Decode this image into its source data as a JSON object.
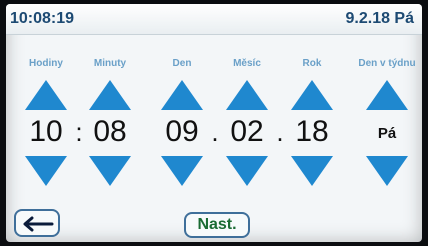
{
  "header": {
    "time": "10:08:19",
    "date": "9.2.18 Pá"
  },
  "fields": [
    {
      "label": "Hodiny",
      "value": "10"
    },
    {
      "label": "Minuty",
      "value": "08"
    },
    {
      "label": "Den",
      "value": "09"
    },
    {
      "label": "Měsíc",
      "value": "02"
    },
    {
      "label": "Rok",
      "value": "18"
    },
    {
      "label": "Den v týdnu",
      "value": "Pá"
    }
  ],
  "separators": {
    "time": ":",
    "date1": ".",
    "date2": "."
  },
  "buttons": {
    "set_label": "Nast."
  },
  "colors": {
    "arrow": "#1f88cf",
    "header_text": "#1d4a73",
    "set_text": "#1a6b33",
    "label": "#6aa0c8"
  },
  "icons": {
    "up": "triangle-up-icon",
    "down": "triangle-down-icon",
    "back": "arrow-left-icon"
  }
}
